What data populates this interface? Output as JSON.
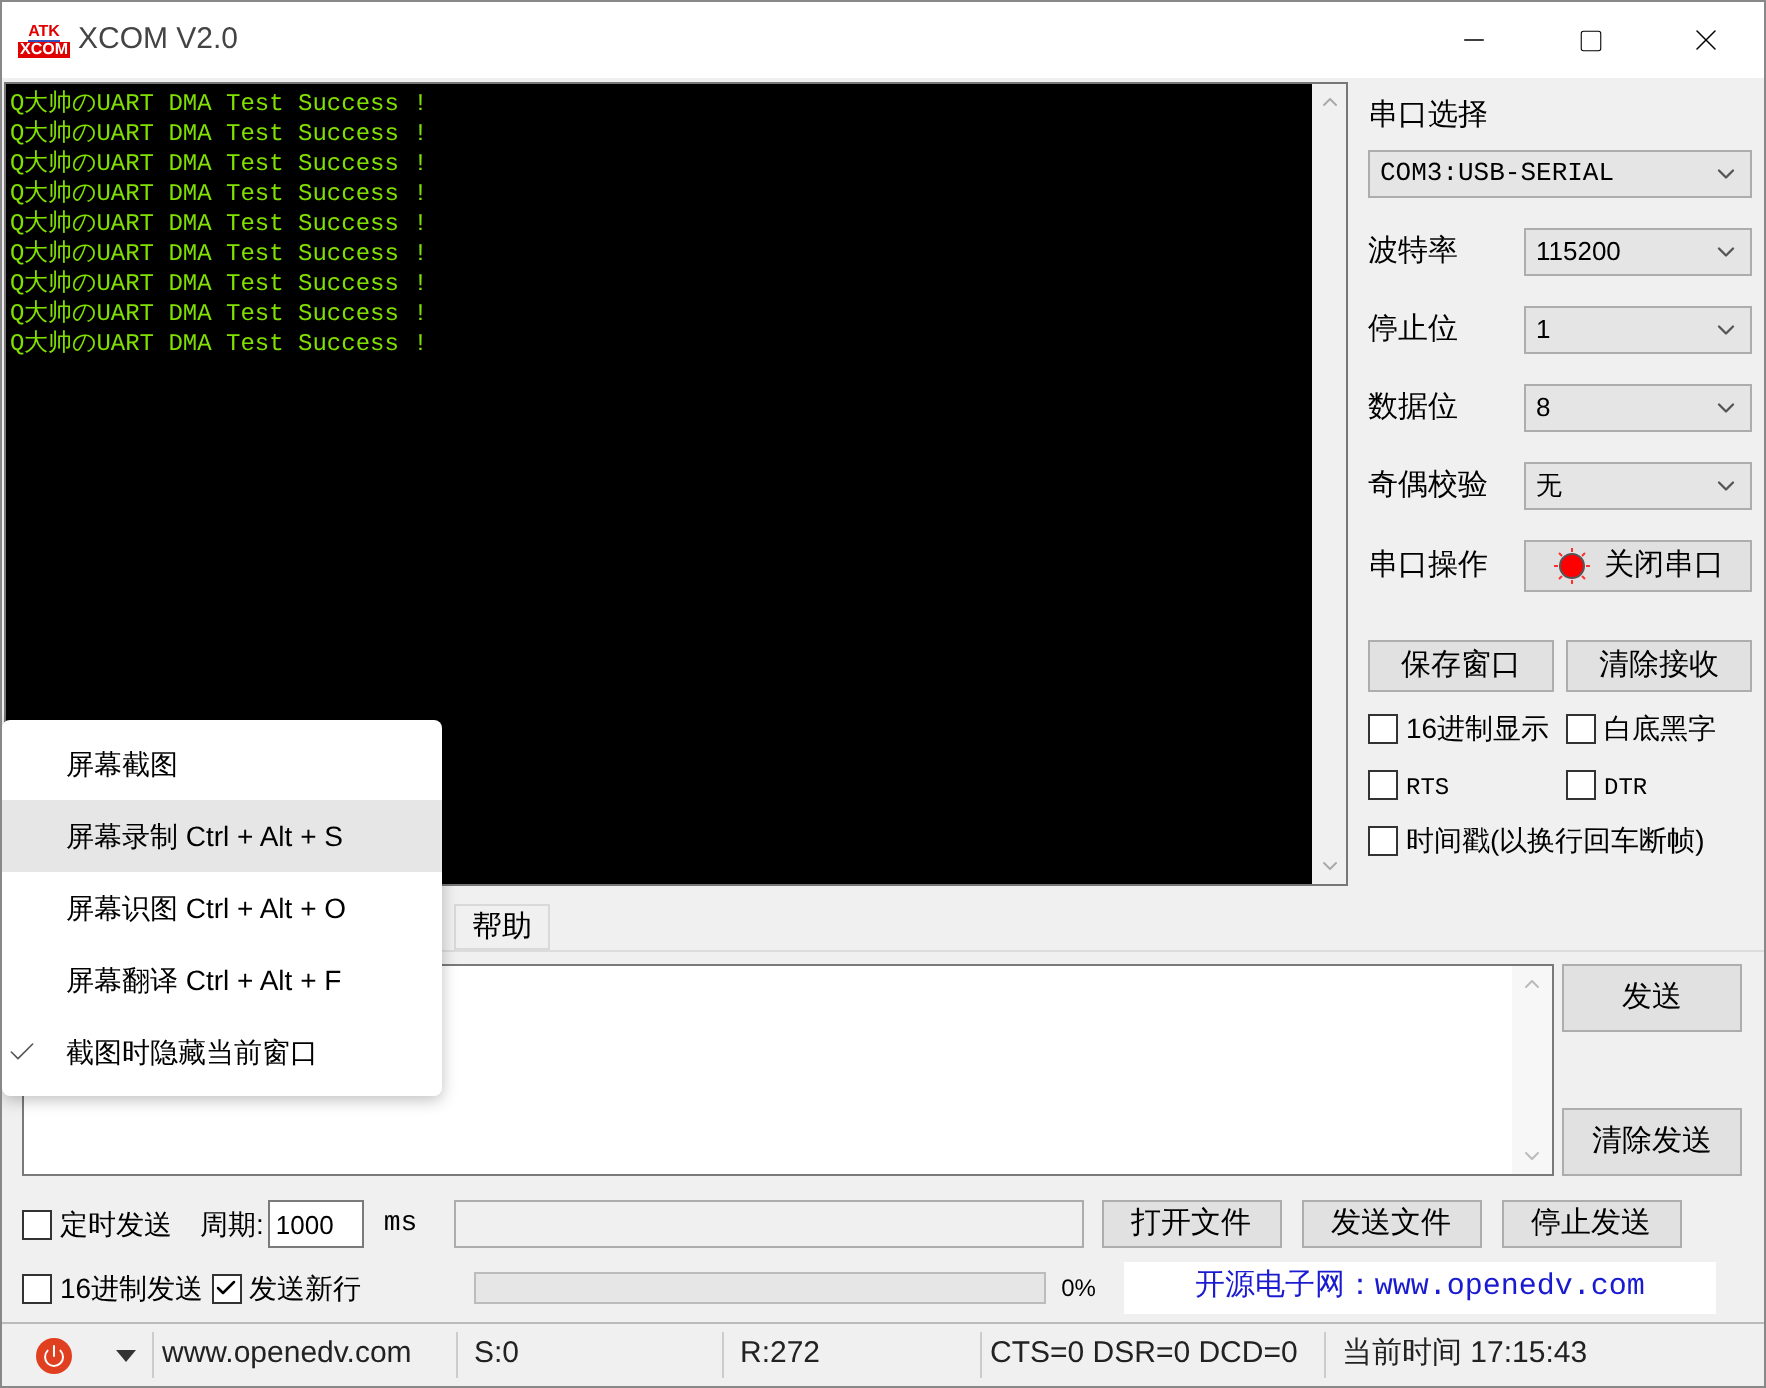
{
  "window": {
    "title": "XCOM V2.0",
    "logo_top": "ATK",
    "logo_bottom": "XCOM"
  },
  "receive_lines": [
    "Q大帅のUART DMA Test Success !",
    "Q大帅のUART DMA Test Success !",
    "Q大帅のUART DMA Test Success !",
    "Q大帅のUART DMA Test Success !",
    "Q大帅のUART DMA Test Success !",
    "Q大帅のUART DMA Test Success !",
    "Q大帅のUART DMA Test Success !",
    "Q大帅のUART DMA Test Success !",
    "Q大帅のUART DMA Test Success !"
  ],
  "port_panel": {
    "title": "串口选择",
    "port": "COM3:USB-SERIAL",
    "settings": [
      {
        "label": "波特率",
        "value": "115200"
      },
      {
        "label": "停止位",
        "value": "1"
      },
      {
        "label": "数据位",
        "value": "8"
      },
      {
        "label": "奇偶校验",
        "value": "无"
      }
    ],
    "operation_label": "串口操作",
    "operation_button": {
      "label": "关闭串口",
      "on": true
    },
    "buttons": [
      "保存窗口",
      "清除接收"
    ],
    "option_rows": [
      [
        {
          "label": "16进制显示",
          "checked": false
        },
        {
          "label": "白底黑字",
          "checked": false
        }
      ],
      [
        {
          "label": "RTS",
          "checked": false
        },
        {
          "label": "DTR",
          "checked": false
        }
      ],
      [
        {
          "label": "时间戳(以换行回车断帧)",
          "checked": false
        }
      ]
    ]
  },
  "tabs": [
    {
      "label": "帮助",
      "selected": false
    }
  ],
  "send_buttons": [
    "发送",
    "清除发送"
  ],
  "bottom": {
    "timed_send": {
      "label": "定时发送",
      "checked": false
    },
    "period_label": "周期:",
    "period_value": "1000",
    "period_unit": "ms",
    "file_buttons": [
      "打开文件",
      "发送文件",
      "停止发送"
    ],
    "hex_send": {
      "label": "16进制发送",
      "checked": false
    },
    "newline": {
      "label": "发送新行",
      "checked": true
    },
    "progress": {
      "level": 0,
      "reading": "0%"
    },
    "banner": "开源电子网：www.openedv.com"
  },
  "status_bar": {
    "site": "www.openedv.com",
    "sent": "S:0",
    "received": "R:272",
    "lines": "CTS=0 DSR=0 DCD=0",
    "time": "当前时间 17:15:43"
  },
  "context_menu": [
    {
      "label": "屏幕截图",
      "hovered": false,
      "checked": false
    },
    {
      "label": "屏幕录制 Ctrl + Alt + S",
      "hovered": true,
      "checked": false
    },
    {
      "label": "屏幕识图 Ctrl + Alt + O",
      "hovered": false,
      "checked": false
    },
    {
      "label": "屏幕翻译 Ctrl + Alt + F",
      "hovered": false,
      "checked": false
    },
    {
      "label": "截图时隐藏当前窗口",
      "hovered": false,
      "checked": true
    }
  ]
}
